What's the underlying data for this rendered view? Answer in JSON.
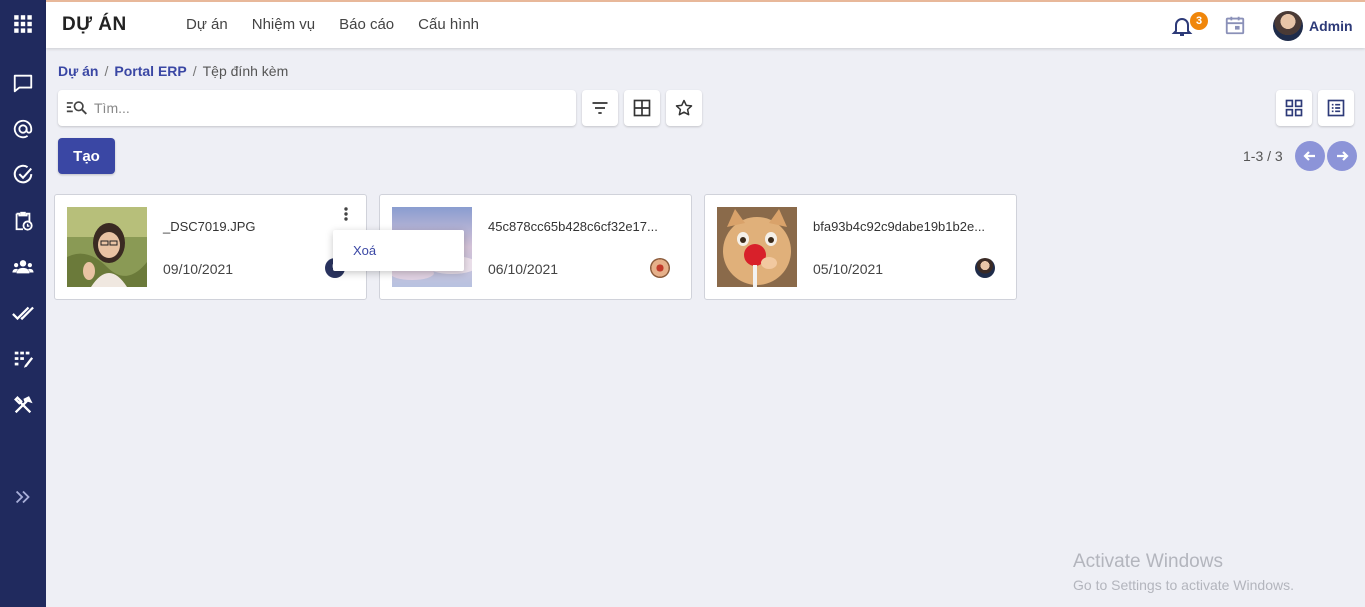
{
  "app": {
    "title": "DỰ ÁN",
    "menu": [
      "Dự án",
      "Nhiệm vụ",
      "Báo cáo",
      "Cấu hình"
    ]
  },
  "header": {
    "notification_count": "3",
    "user_name": "Admin"
  },
  "sidebar": {
    "icons": [
      "apps-grid-icon",
      "chat-icon",
      "at-icon",
      "check-circle-icon",
      "clipboard-clock-icon",
      "team-icon",
      "double-check-icon",
      "task-board-icon",
      "tools-icon",
      "expand-icon"
    ]
  },
  "breadcrumb": {
    "items": [
      "Dự án",
      "Portal ERP",
      "Tệp đính kèm"
    ]
  },
  "search": {
    "placeholder": "Tìm..."
  },
  "toolbar": {
    "create_label": "Tạo",
    "pager": "1-3 / 3"
  },
  "cards": [
    {
      "name": "_DSC7019.JPG",
      "date": "09/10/2021"
    },
    {
      "name": "45c878cc65b428c6cf32e17...",
      "date": "06/10/2021"
    },
    {
      "name": "bfa93b4c92c9dabe19b1b2e...",
      "date": "05/10/2021"
    }
  ],
  "dropdown": {
    "delete_label": "Xoá"
  },
  "watermark": {
    "line1": "Activate Windows",
    "line2": "Go to Settings to activate Windows."
  }
}
